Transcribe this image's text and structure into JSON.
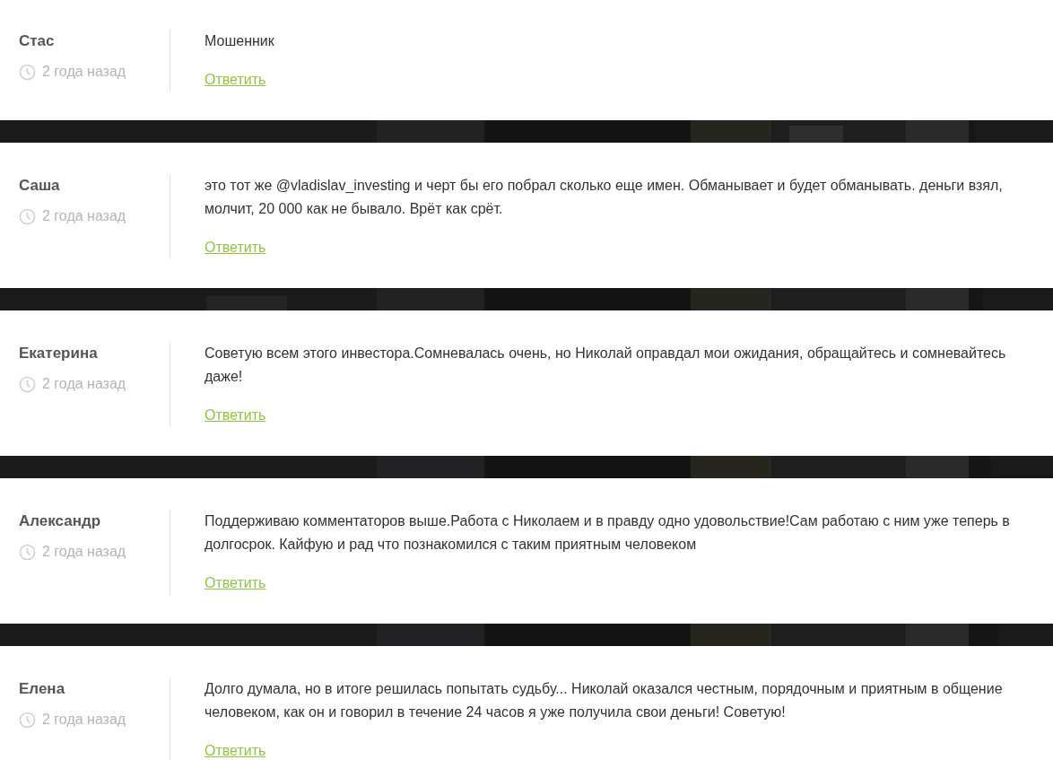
{
  "comments": [
    {
      "author": "Стас",
      "time": "2 года назад",
      "text": "Мошенник",
      "reply": "Ответить"
    },
    {
      "author": "Саша",
      "time": "2 года назад",
      "text": "это тот же @vladislav_investing и черт бы его побрал сколько еще имен. Обманывает и будет обманывать. деньги взял, молчит, 20 000 как не бывало. Врёт как срёт.",
      "reply": "Ответить"
    },
    {
      "author": "Екатерина",
      "time": "2 года назад",
      "text": "Советую всем этого инвестора.Сомневалась очень, но Николай оправдал мои ожидания, обращайтесь и сомневайтесь даже!",
      "reply": "Ответить"
    },
    {
      "author": "Александр",
      "time": "2 года назад",
      "text": "Поддерживаю комментаторов выше.Работа с Николаем и в правду одно удовольствие!Сам работаю с ним уже теперь в долгосрок. Кайфую и рад что познакомился с таким приятным человеком",
      "reply": "Ответить"
    },
    {
      "author": "Елена",
      "time": "2 года назад",
      "text": "Долго думала, но в итоге решилась попытать судьбу... Николай оказался честным, порядочным и приятным в общение человеком, как он и говорил в течение 24 часов я уже получила свои деньги! Советую!",
      "reply": "Ответить"
    }
  ]
}
